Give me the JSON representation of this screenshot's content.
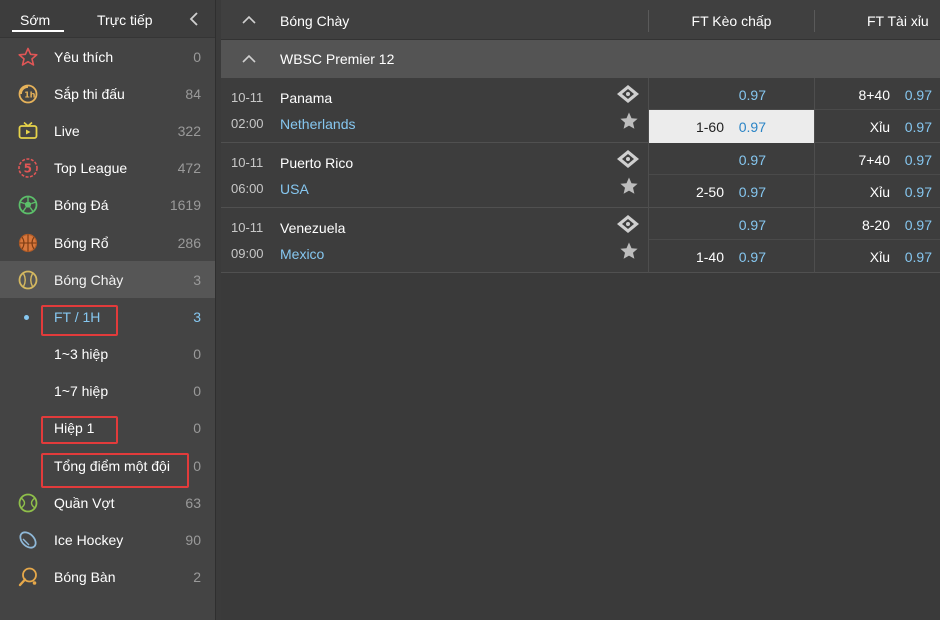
{
  "sidebar": {
    "tabs": {
      "early": "Sớm",
      "live": "Trực tiếp"
    },
    "items": [
      {
        "label": "Yêu thích",
        "count": "0",
        "icon": "star-outline-icon"
      },
      {
        "label": "Sắp thi đấu",
        "count": "84",
        "icon": "one-hour-icon"
      },
      {
        "label": "Live",
        "count": "322",
        "icon": "tv-icon"
      },
      {
        "label": "Top League",
        "count": "472",
        "icon": "five-badge-icon"
      },
      {
        "label": "Bóng Đá",
        "count": "1619",
        "icon": "soccer-ball-icon"
      },
      {
        "label": "Bóng Rổ",
        "count": "286",
        "icon": "basketball-icon"
      },
      {
        "label": "Bóng Chày",
        "count": "3",
        "icon": "baseball-icon"
      }
    ],
    "sub_items": [
      {
        "label": "FT / 1H",
        "count": "3"
      },
      {
        "label": "1~3 hiệp",
        "count": "0"
      },
      {
        "label": "1~7 hiệp",
        "count": "0"
      },
      {
        "label": "Hiệp 1",
        "count": "0"
      },
      {
        "label": "Tổng điểm một đội",
        "count": "0"
      }
    ],
    "items_after": [
      {
        "label": "Quần Vợt",
        "count": "63",
        "icon": "tennis-ball-icon"
      },
      {
        "label": "Ice Hockey",
        "count": "90",
        "icon": "hockey-puck-icon"
      },
      {
        "label": "Bóng Bàn",
        "count": "2",
        "icon": "table-tennis-icon"
      }
    ]
  },
  "main": {
    "sport": "Bóng Chày",
    "col_handicap": "FT Kèo chấp",
    "col_overunder": "FT Tài xỉu",
    "league": "WBSC Premier 12",
    "matches": [
      {
        "date": "10-11",
        "time": "02:00",
        "home": "Panama",
        "away": "Netherlands",
        "hcp_top_odds": "0.97",
        "hcp_bot_line": "1-60",
        "hcp_bot_odds": "0.97",
        "ou_top_line": "8+40",
        "ou_top_odds": "0.97",
        "ou_bot_line": "Xỉu",
        "ou_bot_odds": "0.97"
      },
      {
        "date": "10-11",
        "time": "06:00",
        "home": "Puerto Rico",
        "away": "USA",
        "hcp_top_odds": "0.97",
        "hcp_bot_line": "2-50",
        "hcp_bot_odds": "0.97",
        "ou_top_line": "7+40",
        "ou_top_odds": "0.97",
        "ou_bot_line": "Xỉu",
        "ou_bot_odds": "0.97"
      },
      {
        "date": "10-11",
        "time": "09:00",
        "home": "Venezuela",
        "away": "Mexico",
        "hcp_top_odds": "0.97",
        "hcp_bot_line": "1-40",
        "hcp_bot_odds": "0.97",
        "ou_top_line": "8-20",
        "ou_top_odds": "0.97",
        "ou_bot_line": "Xỉu",
        "ou_bot_odds": "0.97"
      }
    ]
  },
  "colors": {
    "accent": "#86c7f0",
    "highlight_box": "#e23b3b",
    "selected_cell": "#ececec"
  }
}
